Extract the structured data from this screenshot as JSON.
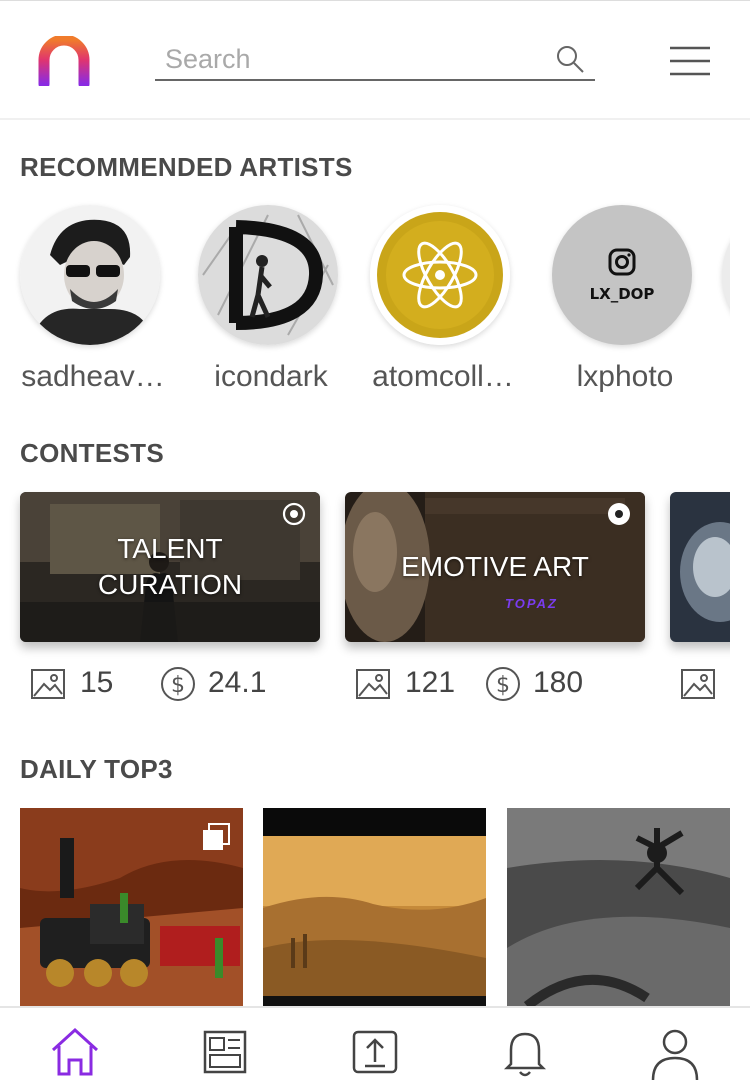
{
  "search": {
    "placeholder": "Search"
  },
  "sections": {
    "artists_title": "RECOMMENDED ARTISTS",
    "contests_title": "CONTESTS",
    "top3_title": "DAILY TOP3"
  },
  "artists": [
    {
      "name": "sadheav…"
    },
    {
      "name": "icondark"
    },
    {
      "name": "atomcoll…"
    },
    {
      "name": "lxphoto",
      "avatar_text": "LX_DOP"
    }
  ],
  "contests": [
    {
      "title": "TALENT CURATION",
      "images": "15",
      "prize": "24.1"
    },
    {
      "title": "EMOTIVE ART",
      "banner_text": "TOPAZ",
      "images": "121",
      "prize": "180"
    }
  ],
  "colors": {
    "accent": "#8a2be2",
    "logo_top": "#f07b2c",
    "logo_bottom": "#8a2be2"
  },
  "icons": {
    "nav": [
      "home-icon",
      "feed-icon",
      "upload-icon",
      "bell-icon",
      "user-icon"
    ],
    "active_nav": "home-icon"
  }
}
